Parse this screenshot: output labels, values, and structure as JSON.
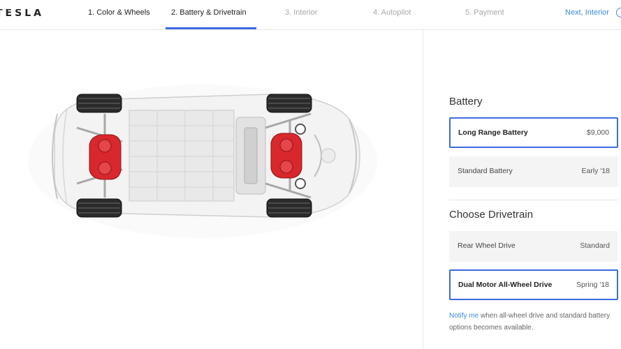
{
  "brand": {
    "logo_text": "TESLA"
  },
  "steps": [
    {
      "label": "1. Color & Wheels",
      "state": "done"
    },
    {
      "label": "2. Battery & Drivetrain",
      "state": "active"
    },
    {
      "label": "3. Interior",
      "state": "future"
    },
    {
      "label": "4. Autopilot",
      "state": "future"
    },
    {
      "label": "5. Payment",
      "state": "future"
    }
  ],
  "next_link": {
    "label": "Next, Interior"
  },
  "colors": {
    "accent_blue": "#3e6ae1",
    "link_blue": "#3e8bd6",
    "motor_red": "#d8282d"
  },
  "battery": {
    "title": "Battery",
    "options": [
      {
        "name": "Long Range Battery",
        "price": "$9,000",
        "selected": true
      },
      {
        "name": "Standard Battery",
        "price": "Early '18",
        "selected": false
      }
    ]
  },
  "drivetrain": {
    "title": "Choose Drivetrain",
    "options": [
      {
        "name": "Rear Wheel Drive",
        "price": "Standard",
        "selected": false
      },
      {
        "name": "Dual Motor All-Wheel Drive",
        "price": "Spring '18",
        "selected": true
      }
    ]
  },
  "notify": {
    "link_text": "Notify me",
    "rest_text": " when all-wheel drive and standard battery options becomes available."
  }
}
